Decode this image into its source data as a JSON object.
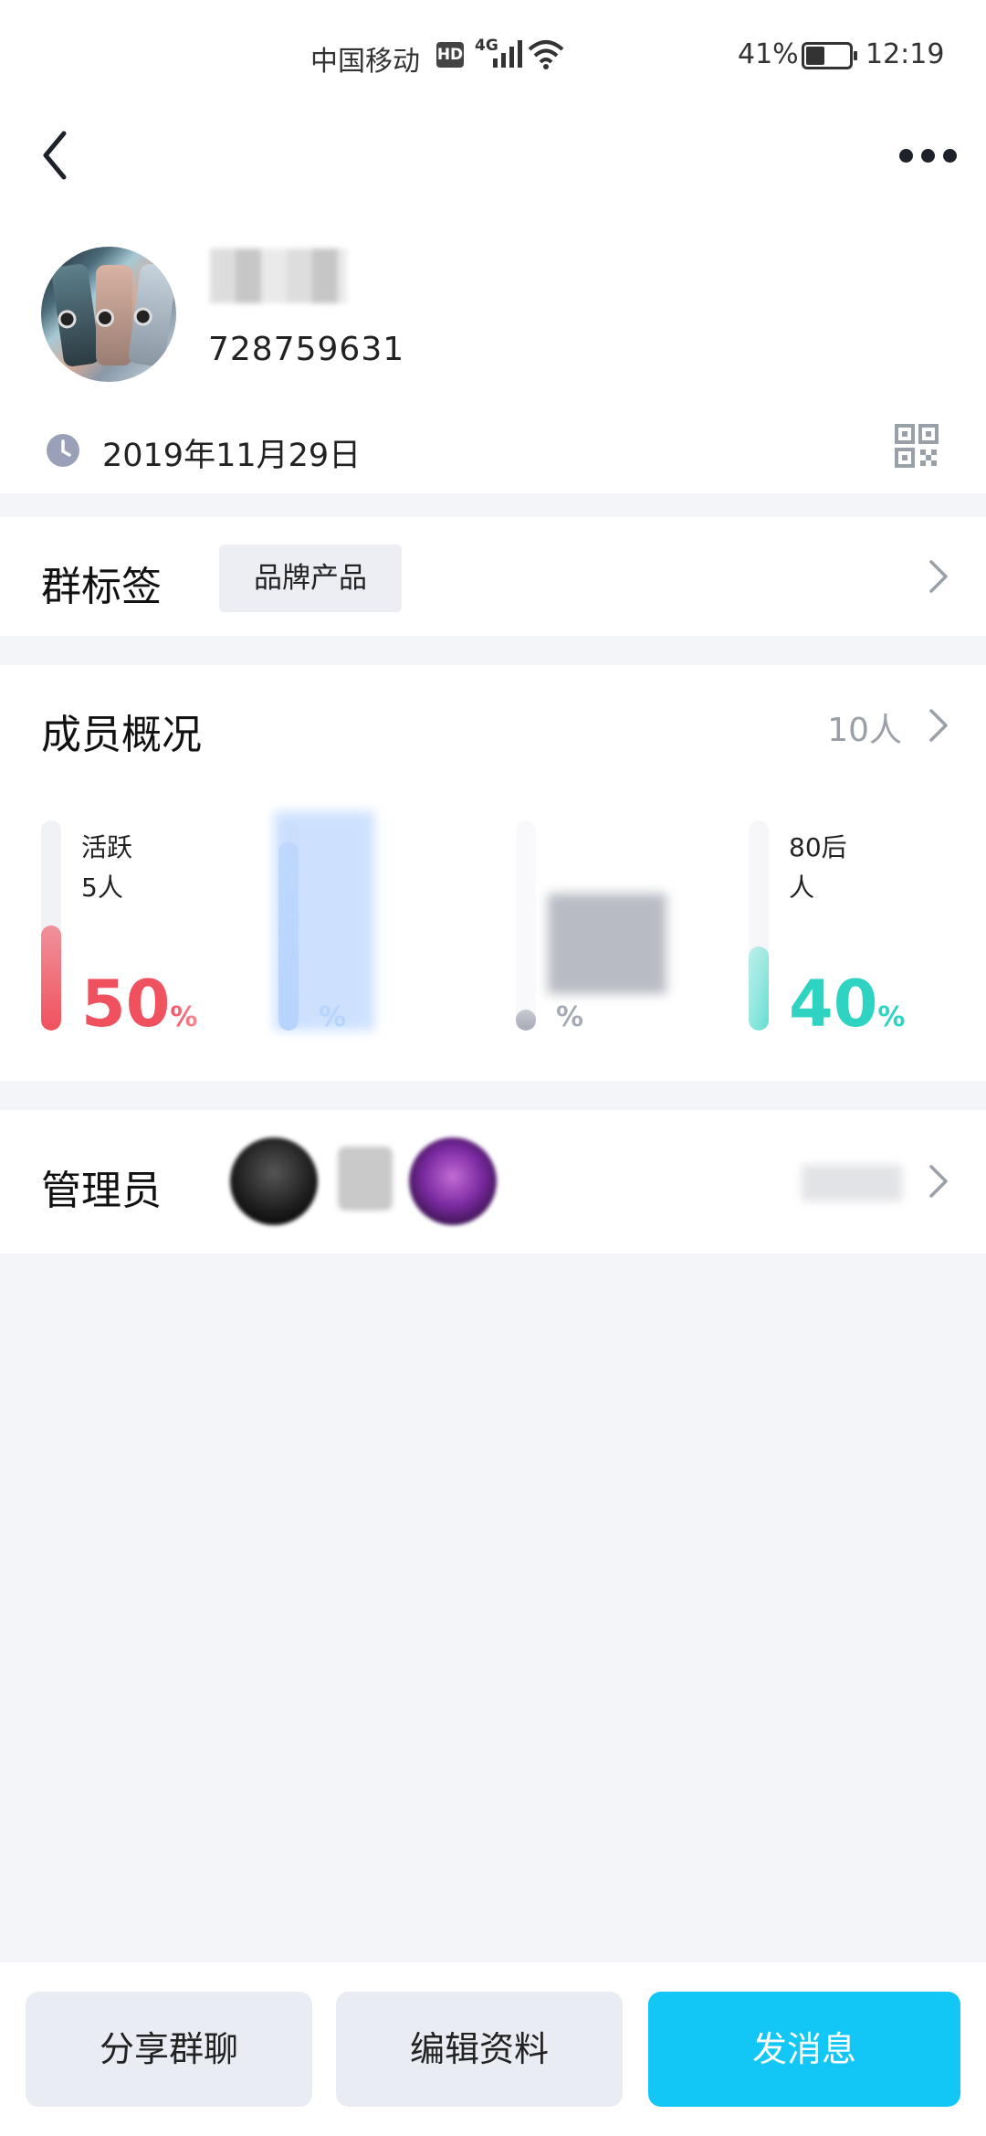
{
  "status_bar": {
    "carrier": "中国移动",
    "hd_badge": "HD",
    "network": "4G",
    "battery_percent": "41%",
    "time": "12:19"
  },
  "header": {
    "group_id": "728759631",
    "create_date": "2019年11月29日"
  },
  "tags": {
    "title": "群标签",
    "chip": "品牌产品"
  },
  "members": {
    "title": "成员概况",
    "count": "10人",
    "stats": [
      {
        "label": "活跃",
        "sub": "5人",
        "percent": "50",
        "unit": "%",
        "level": 0.5,
        "color": "#f0515e"
      },
      {
        "label": "",
        "sub": "",
        "percent": "",
        "unit": "%",
        "level": 0.9,
        "color": "#5b9cf5"
      },
      {
        "label": "",
        "sub": "",
        "percent": "",
        "unit": "%",
        "level": 0.1,
        "color": "#3d4560"
      },
      {
        "label": "80后",
        "sub": "人",
        "percent": "40",
        "unit": "%",
        "level": 0.4,
        "color": "#2ed3c2"
      }
    ]
  },
  "admins": {
    "title": "管理员"
  },
  "actions": {
    "share": "分享群聊",
    "edit": "编辑资料",
    "send": "发消息"
  },
  "colors": {
    "accent": "#12c7f5",
    "page_bg": "#f4f5f9"
  }
}
